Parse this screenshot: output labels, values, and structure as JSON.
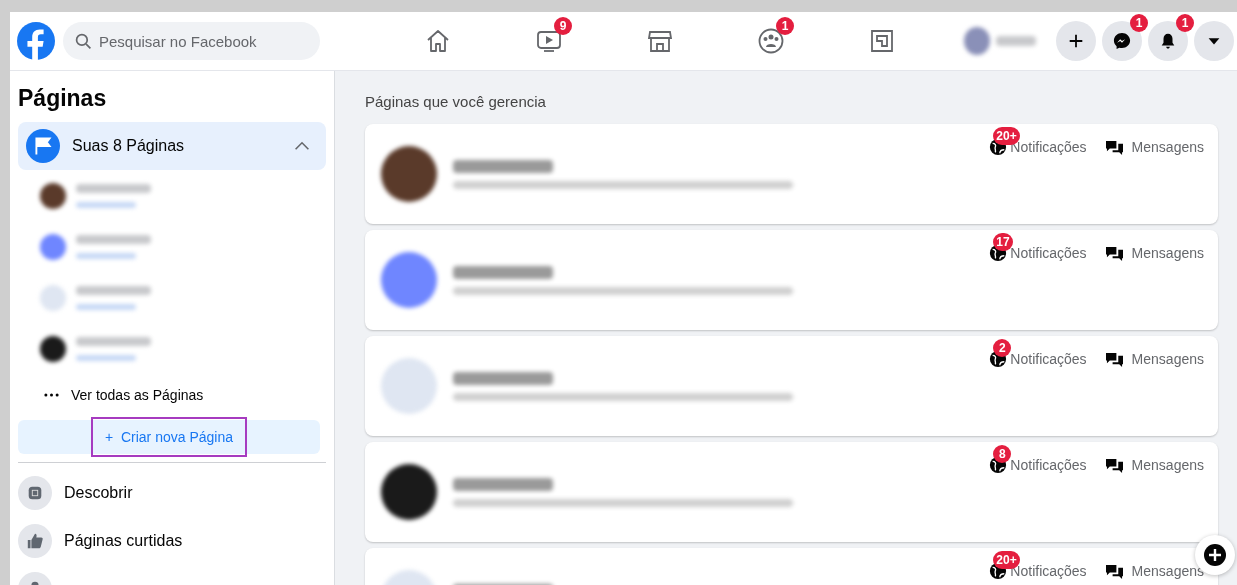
{
  "header": {
    "search": {
      "placeholder": "Pesquisar no Facebook"
    },
    "nav": [
      {
        "kind": "home"
      },
      {
        "kind": "video",
        "badge": "9"
      },
      {
        "kind": "store"
      },
      {
        "kind": "groups",
        "badge": "1"
      },
      {
        "kind": "gaming"
      }
    ],
    "actions": [
      {
        "kind": "plus"
      },
      {
        "kind": "messenger",
        "badge": "1"
      },
      {
        "kind": "bell",
        "badge": "1"
      },
      {
        "kind": "caret"
      }
    ]
  },
  "sidebar": {
    "title": "Páginas",
    "section": {
      "label": "Suas 8 Páginas",
      "expanded": true
    },
    "pages": [
      {
        "kind": "photo"
      },
      {
        "kind": "blue"
      },
      {
        "kind": "logo"
      },
      {
        "kind": "dark"
      }
    ],
    "see_all": "Ver todas as Páginas",
    "create_button": {
      "label": "Criar nova Página",
      "icon": "+",
      "highlighted": true
    },
    "menu": [
      {
        "kind": "discover",
        "label": "Descobrir"
      },
      {
        "kind": "like",
        "label": "Páginas curtidas"
      },
      {
        "kind": "person"
      }
    ]
  },
  "main": {
    "heading": "Páginas que você gerencia",
    "cards": [
      {
        "kind": "photo",
        "badge": "20+",
        "notifications": "Notificações",
        "messages": "Mensagens"
      },
      {
        "kind": "blue",
        "badge": "17",
        "notifications": "Notificações",
        "messages": "Mensagens"
      },
      {
        "kind": "logo",
        "badge": "2",
        "notifications": "Notificações",
        "messages": "Mensagens"
      },
      {
        "kind": "dark",
        "badge": "8",
        "notifications": "Notificações",
        "messages": "Mensagens"
      },
      {
        "kind": "logo",
        "badge": "20+",
        "notifications": "Notificações",
        "messages": "Mensagens"
      }
    ]
  }
}
